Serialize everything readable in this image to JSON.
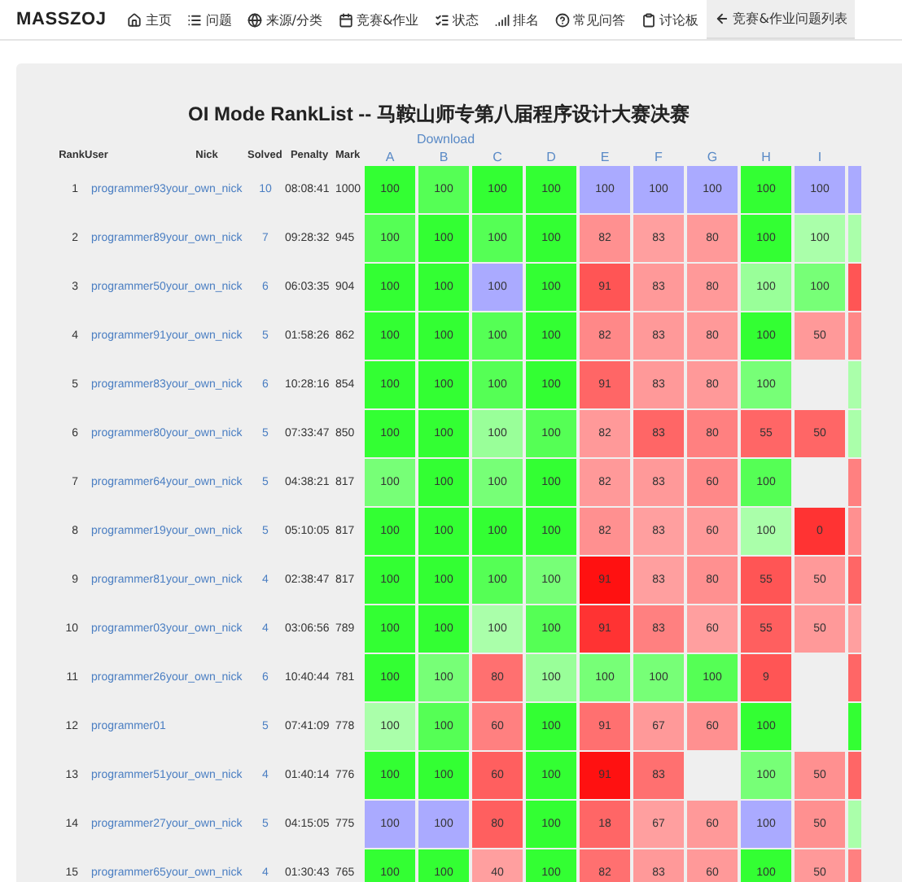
{
  "nav": {
    "brand": "MASSZOJ",
    "items": [
      {
        "label": "主页",
        "selected": false
      },
      {
        "label": "问题",
        "selected": false
      },
      {
        "label": "来源/分类",
        "selected": false
      },
      {
        "label": "竞赛&作业",
        "selected": false
      },
      {
        "label": "状态",
        "selected": false
      },
      {
        "label": "排名",
        "selected": false
      },
      {
        "label": "常见问答",
        "selected": false
      },
      {
        "label": "讨论板",
        "selected": false
      },
      {
        "label": "竞赛&作业问题列表",
        "selected": true
      }
    ]
  },
  "title": {
    "mode": "OI Mode RankList --",
    "contest": "马鞍山师专第八届程序设计大赛决赛"
  },
  "download": "Download",
  "table": {
    "columns": [
      "Rank",
      "User",
      "Nick",
      "Solved",
      "Penalty",
      "Mark"
    ],
    "problems": [
      "A",
      "B",
      "C",
      "D",
      "E",
      "F",
      "G",
      "H",
      "I"
    ],
    "rows": [
      {
        "rank": "1",
        "user": "programmer93",
        "nick": "your_own_nick",
        "solved": "10",
        "penalty": "08:08:41",
        "mark": "1000",
        "cells": [
          {
            "score": "100",
            "color": "#33ff33"
          },
          {
            "score": "100",
            "color": "#55ff55"
          },
          {
            "score": "100",
            "color": "#33ff33"
          },
          {
            "score": "100",
            "color": "#33ff33"
          },
          {
            "score": "100",
            "color": "#aaaaff"
          },
          {
            "score": "100",
            "color": "#aaaaff"
          },
          {
            "score": "100",
            "color": "#aaaaff"
          },
          {
            "score": "100",
            "color": "#33ff33"
          },
          {
            "score": "100",
            "color": "#aaaaff"
          },
          {
            "color": "#aaaaff"
          }
        ]
      },
      {
        "rank": "2",
        "user": "programmer89",
        "nick": "your_own_nick",
        "solved": "7",
        "penalty": "09:28:32",
        "mark": "945",
        "cells": [
          {
            "score": "100",
            "color": "#55ff55"
          },
          {
            "score": "100",
            "color": "#33ff33"
          },
          {
            "score": "100",
            "color": "#55ff55"
          },
          {
            "score": "100",
            "color": "#33ff33"
          },
          {
            "score": "82",
            "color": "#ff9090"
          },
          {
            "score": "83",
            "color": "#ff9f9f"
          },
          {
            "score": "80",
            "color": "#ff9999"
          },
          {
            "score": "100",
            "color": "#33ff33"
          },
          {
            "score": "100",
            "color": "#aaffaa"
          },
          {
            "color": "#aaffaa"
          }
        ]
      },
      {
        "rank": "3",
        "user": "programmer50",
        "nick": "your_own_nick",
        "solved": "6",
        "penalty": "06:03:35",
        "mark": "904",
        "cells": [
          {
            "score": "100",
            "color": "#33ff33"
          },
          {
            "score": "100",
            "color": "#33ff33"
          },
          {
            "score": "100",
            "color": "#aaaaff"
          },
          {
            "score": "100",
            "color": "#33ff33"
          },
          {
            "score": "91",
            "color": "#ff5555"
          },
          {
            "score": "83",
            "color": "#ff9999"
          },
          {
            "score": "80",
            "color": "#ff9999"
          },
          {
            "score": "100",
            "color": "#99ff99"
          },
          {
            "score": "100",
            "color": "#77ff77"
          },
          {
            "color": "#ff5555"
          }
        ]
      },
      {
        "rank": "4",
        "user": "programmer91",
        "nick": "your_own_nick",
        "solved": "5",
        "penalty": "01:58:26",
        "mark": "862",
        "cells": [
          {
            "score": "100",
            "color": "#33ff33"
          },
          {
            "score": "100",
            "color": "#33ff33"
          },
          {
            "score": "100",
            "color": "#55ff55"
          },
          {
            "score": "100",
            "color": "#33ff33"
          },
          {
            "score": "82",
            "color": "#ff8888"
          },
          {
            "score": "83",
            "color": "#ff9999"
          },
          {
            "score": "80",
            "color": "#ff9999"
          },
          {
            "score": "100",
            "color": "#33ff33"
          },
          {
            "score": "50",
            "color": "#ff9999"
          },
          {
            "color": "#ff8888"
          }
        ]
      },
      {
        "rank": "5",
        "user": "programmer83",
        "nick": "your_own_nick",
        "solved": "6",
        "penalty": "10:28:16",
        "mark": "854",
        "cells": [
          {
            "score": "100",
            "color": "#33ff33"
          },
          {
            "score": "100",
            "color": "#33ff33"
          },
          {
            "score": "100",
            "color": "#55ff55"
          },
          {
            "score": "100",
            "color": "#33ff33"
          },
          {
            "score": "91",
            "color": "#ff6666"
          },
          {
            "score": "83",
            "color": "#ff9999"
          },
          {
            "score": "80",
            "color": "#ff9999"
          },
          {
            "score": "100",
            "color": "#77ff77"
          },
          null,
          {
            "color": "#aaffaa"
          }
        ]
      },
      {
        "rank": "6",
        "user": "programmer80",
        "nick": "your_own_nick",
        "solved": "5",
        "penalty": "07:33:47",
        "mark": "850",
        "cells": [
          {
            "score": "100",
            "color": "#33ff33"
          },
          {
            "score": "100",
            "color": "#33ff33"
          },
          {
            "score": "100",
            "color": "#99ff99"
          },
          {
            "score": "100",
            "color": "#55ff55"
          },
          {
            "score": "82",
            "color": "#ff9999"
          },
          {
            "score": "83",
            "color": "#ff6666"
          },
          {
            "score": "80",
            "color": "#ff8080"
          },
          {
            "score": "55",
            "color": "#ff6666"
          },
          {
            "score": "50",
            "color": "#ff6666"
          },
          {
            "color": "#aaffaa"
          }
        ]
      },
      {
        "rank": "7",
        "user": "programmer64",
        "nick": "your_own_nick",
        "solved": "5",
        "penalty": "04:38:21",
        "mark": "817",
        "cells": [
          {
            "score": "100",
            "color": "#77ff77"
          },
          {
            "score": "100",
            "color": "#33ff33"
          },
          {
            "score": "100",
            "color": "#77ff77"
          },
          {
            "score": "100",
            "color": "#33ff33"
          },
          {
            "score": "82",
            "color": "#ff9999"
          },
          {
            "score": "83",
            "color": "#ff9999"
          },
          {
            "score": "60",
            "color": "#ff8888"
          },
          {
            "score": "100",
            "color": "#55ff55"
          },
          null,
          {
            "color": "#ff8080"
          }
        ]
      },
      {
        "rank": "8",
        "user": "programmer19",
        "nick": "your_own_nick",
        "solved": "5",
        "penalty": "05:10:05",
        "mark": "817",
        "cells": [
          {
            "score": "100",
            "color": "#33ff33"
          },
          {
            "score": "100",
            "color": "#33ff33"
          },
          {
            "score": "100",
            "color": "#33ff33"
          },
          {
            "score": "100",
            "color": "#33ff33"
          },
          {
            "score": "82",
            "color": "#ff9090"
          },
          {
            "score": "83",
            "color": "#ff9f9f"
          },
          {
            "score": "60",
            "color": "#ff9999"
          },
          {
            "score": "100",
            "color": "#aaffaa"
          },
          {
            "score": "0",
            "color": "#ff3333"
          },
          {
            "color": "#ff9090"
          }
        ]
      },
      {
        "rank": "9",
        "user": "programmer81",
        "nick": "your_own_nick",
        "solved": "4",
        "penalty": "02:38:47",
        "mark": "817",
        "cells": [
          {
            "score": "100",
            "color": "#33ff33"
          },
          {
            "score": "100",
            "color": "#33ff33"
          },
          {
            "score": "100",
            "color": "#55ff55"
          },
          {
            "score": "100",
            "color": "#77ff77"
          },
          {
            "score": "91",
            "color": "#ff1111"
          },
          {
            "score": "83",
            "color": "#ff9f9f"
          },
          {
            "score": "80",
            "color": "#ff9090"
          },
          {
            "score": "55",
            "color": "#ff5555"
          },
          {
            "score": "50",
            "color": "#ff9999"
          },
          {
            "color": "#ff6666"
          }
        ]
      },
      {
        "rank": "10",
        "user": "programmer03",
        "nick": "your_own_nick",
        "solved": "4",
        "penalty": "03:06:56",
        "mark": "789",
        "cells": [
          {
            "score": "100",
            "color": "#33ff33"
          },
          {
            "score": "100",
            "color": "#33ff33"
          },
          {
            "score": "100",
            "color": "#aaffaa"
          },
          {
            "score": "100",
            "color": "#55ff55"
          },
          {
            "score": "91",
            "color": "#ff3333"
          },
          {
            "score": "83",
            "color": "#ff8080"
          },
          {
            "score": "60",
            "color": "#ff9f9f"
          },
          {
            "score": "55",
            "color": "#ff5f5f"
          },
          {
            "score": "50",
            "color": "#ff9999"
          },
          {
            "color": "#ff9f9f"
          }
        ]
      },
      {
        "rank": "11",
        "user": "programmer26",
        "nick": "your_own_nick",
        "solved": "6",
        "penalty": "10:40:44",
        "mark": "781",
        "cells": [
          {
            "score": "100",
            "color": "#33ff33"
          },
          {
            "score": "100",
            "color": "#77ff77"
          },
          {
            "score": "80",
            "color": "#ff7070"
          },
          {
            "score": "100",
            "color": "#99ff99"
          },
          {
            "score": "100",
            "color": "#77ff77"
          },
          {
            "score": "100",
            "color": "#77ff77"
          },
          {
            "score": "100",
            "color": "#55ff55"
          },
          {
            "score": "9",
            "color": "#ff5555"
          },
          null,
          {
            "color": "#ff6666"
          }
        ]
      },
      {
        "rank": "12",
        "user": "programmer01",
        "solved": "5",
        "penalty": "07:41:09",
        "mark": "778",
        "cells": [
          {
            "score": "100",
            "color": "#aaffaa"
          },
          {
            "score": "100",
            "color": "#55ff55"
          },
          {
            "score": "60",
            "color": "#ff8080"
          },
          {
            "score": "100",
            "color": "#33ff33"
          },
          {
            "score": "91",
            "color": "#ff7070"
          },
          {
            "score": "67",
            "color": "#ff9999"
          },
          {
            "score": "60",
            "color": "#ff9090"
          },
          {
            "score": "100",
            "color": "#33ff33"
          },
          null,
          {
            "color": "#33ff33"
          }
        ]
      },
      {
        "rank": "13",
        "user": "programmer51",
        "nick": "your_own_nick",
        "solved": "4",
        "penalty": "01:40:14",
        "mark": "776",
        "cells": [
          {
            "score": "100",
            "color": "#33ff33"
          },
          {
            "score": "100",
            "color": "#33ff33"
          },
          {
            "score": "60",
            "color": "#ff5f5f"
          },
          {
            "score": "100",
            "color": "#33ff33"
          },
          {
            "score": "91",
            "color": "#ff1111"
          },
          {
            "score": "83",
            "color": "#ff7070"
          },
          null,
          {
            "score": "100",
            "color": "#77ff77"
          },
          {
            "score": "50",
            "color": "#ff9090"
          },
          {
            "color": "#ff6666"
          }
        ]
      },
      {
        "rank": "14",
        "user": "programmer27",
        "nick": "your_own_nick",
        "solved": "5",
        "penalty": "04:15:05",
        "mark": "775",
        "cells": [
          {
            "score": "100",
            "color": "#aaaaff"
          },
          {
            "score": "100",
            "color": "#aaaaff"
          },
          {
            "score": "80",
            "color": "#ff5f5f"
          },
          {
            "score": "100",
            "color": "#33ff33"
          },
          {
            "score": "18",
            "color": "#ff6666"
          },
          {
            "score": "67",
            "color": "#ff9f9f"
          },
          {
            "score": "60",
            "color": "#ff9999"
          },
          {
            "score": "100",
            "color": "#aaaaff"
          },
          {
            "score": "50",
            "color": "#ff9090"
          },
          {
            "color": "#aaffaa"
          }
        ]
      },
      {
        "rank": "15",
        "user": "programmer65",
        "nick": "your_own_nick",
        "solved": "4",
        "penalty": "01:30:43",
        "mark": "765",
        "cells": [
          {
            "score": "100",
            "color": "#33ff33"
          },
          {
            "score": "100",
            "color": "#33ff33"
          },
          {
            "score": "40",
            "color": "#ff9f9f"
          },
          {
            "score": "100",
            "color": "#33ff33"
          },
          {
            "score": "82",
            "color": "#ff7070"
          },
          {
            "score": "83",
            "color": "#ff9999"
          },
          {
            "score": "60",
            "color": "#ff9999"
          },
          {
            "score": "100",
            "color": "#33ff33"
          },
          {
            "score": "50",
            "color": "#ff9999"
          },
          {
            "color": "#ff8080"
          }
        ]
      }
    ]
  }
}
